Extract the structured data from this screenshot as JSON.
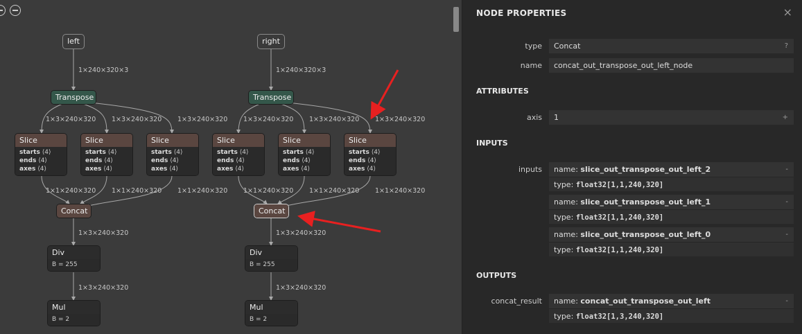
{
  "graph": {
    "inputs": {
      "left": "left",
      "right": "right"
    },
    "transpose_label": "Transpose",
    "slice_label": "Slice",
    "concat_label": "Concat",
    "div_label": "Div",
    "mul_label": "Mul",
    "attr_starts": "starts",
    "attr_ends": "ends",
    "attr_axes": "axes",
    "attr_value": "⟨4⟩",
    "div_attr": "B = 255",
    "mul_attr": "B = 2",
    "edge_labels": {
      "input": "1×240×320×3",
      "transposed": "1×3×240×320",
      "sliced": "1×1×240×320",
      "concat": "1×3×240×320"
    }
  },
  "panel": {
    "title": "NODE PROPERTIES",
    "close_icon": "×",
    "type_label": "type",
    "type_value": "Concat",
    "type_help": "?",
    "name_label": "name",
    "name_value": "concat_out_transpose_out_left_node",
    "attributes_title": "ATTRIBUTES",
    "axis_label": "axis",
    "axis_value": "1",
    "axis_action": "+",
    "inputs_title": "INPUTS",
    "inputs_label": "inputs",
    "name_prefix": "name: ",
    "type_prefix": "type: ",
    "minus": "-",
    "inputs": [
      {
        "name": "slice_out_transpose_out_left_2",
        "type": "float32[1,1,240,320]"
      },
      {
        "name": "slice_out_transpose_out_left_1",
        "type": "float32[1,1,240,320]"
      },
      {
        "name": "slice_out_transpose_out_left_0",
        "type": "float32[1,1,240,320]"
      }
    ],
    "outputs_title": "OUTPUTS",
    "output_label": "concat_result",
    "output": {
      "name": "concat_out_transpose_out_left",
      "type": "float32[1,3,240,320]"
    }
  }
}
